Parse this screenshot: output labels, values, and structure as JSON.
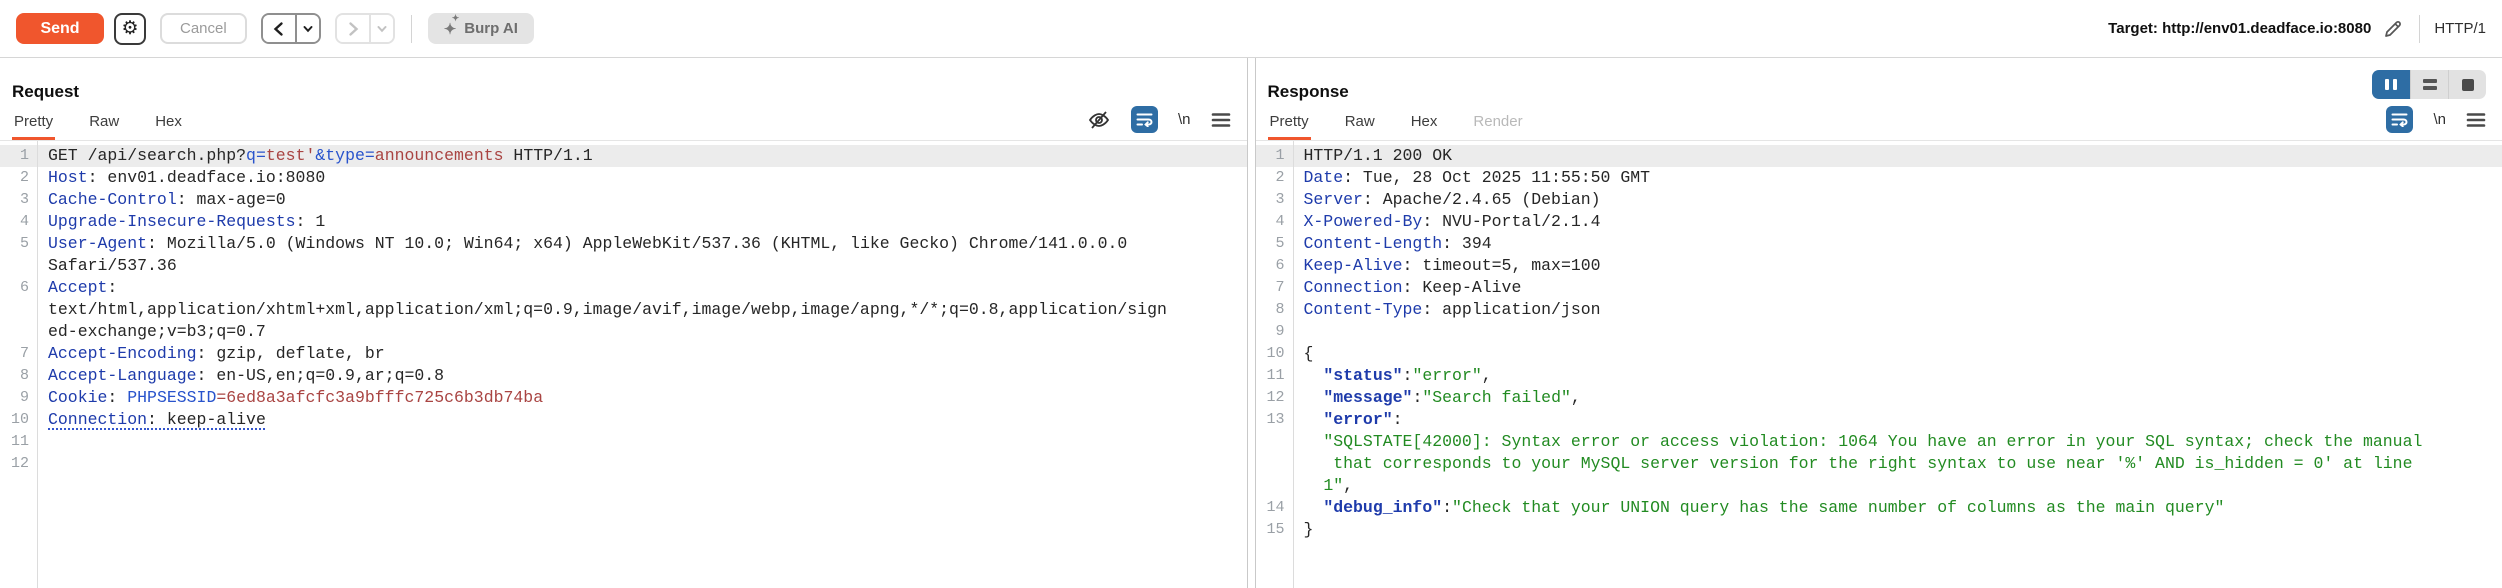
{
  "toolbar": {
    "send_label": "Send",
    "cancel_label": "Cancel",
    "burp_ai_label": "Burp AI",
    "target_text": "Target: http://env01.deadface.io:8080",
    "http_version": "HTTP/1",
    "accent_orange": "#f0562d",
    "accent_blue": "#2e6da4"
  },
  "request": {
    "title": "Request",
    "tabs": [
      {
        "label": "Pretty",
        "state": "active"
      },
      {
        "label": "Raw",
        "state": "normal"
      },
      {
        "label": "Hex",
        "state": "normal"
      }
    ],
    "newline_toggle_label": "\\n",
    "lines": [
      {
        "n": "1",
        "hl": true,
        "segs": [
          [
            "p",
            "GET /api/search.php?"
          ],
          [
            "q",
            "q="
          ],
          [
            "v",
            "test'"
          ],
          [
            "q",
            "&type="
          ],
          [
            "v",
            "announcements"
          ],
          [
            "p",
            " HTTP/1.1"
          ]
        ]
      },
      {
        "n": "2",
        "segs": [
          [
            "k",
            "Host"
          ],
          [
            "p",
            ": env01.deadface.io:8080"
          ]
        ]
      },
      {
        "n": "3",
        "segs": [
          [
            "k",
            "Cache-Control"
          ],
          [
            "p",
            ": max-age=0"
          ]
        ]
      },
      {
        "n": "4",
        "segs": [
          [
            "k",
            "Upgrade-Insecure-Requests"
          ],
          [
            "p",
            ": 1"
          ]
        ]
      },
      {
        "n": "5",
        "segs": [
          [
            "k",
            "User-Agent"
          ],
          [
            "p",
            ": Mozilla/5.0 (Windows NT 10.0; Win64; x64) AppleWebKit/537.36 (KHTML, like Gecko) Chrome/141.0.0.0"
          ]
        ]
      },
      {
        "n": "",
        "segs": [
          [
            "p",
            "Safari/537.36"
          ]
        ]
      },
      {
        "n": "6",
        "segs": [
          [
            "k",
            "Accept"
          ],
          [
            "p",
            ":"
          ]
        ]
      },
      {
        "n": "",
        "segs": [
          [
            "p",
            "text/html,application/xhtml+xml,application/xml;q=0.9,image/avif,image/webp,image/apng,*/*;q=0.8,application/sign"
          ]
        ]
      },
      {
        "n": "",
        "segs": [
          [
            "p",
            "ed-exchange;v=b3;q=0.7"
          ]
        ]
      },
      {
        "n": "7",
        "segs": [
          [
            "k",
            "Accept-Encoding"
          ],
          [
            "p",
            ": gzip, deflate, br"
          ]
        ]
      },
      {
        "n": "8",
        "segs": [
          [
            "k",
            "Accept-Language"
          ],
          [
            "p",
            ": en-US,en;q=0.9,ar;q=0.8"
          ]
        ]
      },
      {
        "n": "9",
        "segs": [
          [
            "k",
            "Cookie"
          ],
          [
            "p",
            ": "
          ],
          [
            "q",
            "PHPSESSID"
          ],
          [
            "v",
            "=6ed8a3afcfc3a9bfffc725c6b3db74ba"
          ]
        ]
      },
      {
        "n": "10",
        "u": true,
        "segs": [
          [
            "k",
            "Connection"
          ],
          [
            "p",
            ": keep-alive"
          ]
        ]
      },
      {
        "n": "11",
        "segs": []
      },
      {
        "n": "12",
        "segs": []
      }
    ]
  },
  "response": {
    "title": "Response",
    "tabs": [
      {
        "label": "Pretty",
        "state": "active"
      },
      {
        "label": "Raw",
        "state": "normal"
      },
      {
        "label": "Hex",
        "state": "normal"
      },
      {
        "label": "Render",
        "state": "disabled"
      }
    ],
    "newline_toggle_label": "\\n",
    "lines": [
      {
        "n": "1",
        "hl": true,
        "segs": [
          [
            "p",
            "HTTP/1.1 200 OK"
          ]
        ]
      },
      {
        "n": "2",
        "segs": [
          [
            "k",
            "Date"
          ],
          [
            "p",
            ": Tue, 28 Oct 2025 11:55:50 GMT"
          ]
        ]
      },
      {
        "n": "3",
        "segs": [
          [
            "k",
            "Server"
          ],
          [
            "p",
            ": Apache/2.4.65 (Debian)"
          ]
        ]
      },
      {
        "n": "4",
        "segs": [
          [
            "k",
            "X-Powered-By"
          ],
          [
            "p",
            ": NVU-Portal/2.1.4"
          ]
        ]
      },
      {
        "n": "5",
        "segs": [
          [
            "k",
            "Content-Length"
          ],
          [
            "p",
            ": 394"
          ]
        ]
      },
      {
        "n": "6",
        "segs": [
          [
            "k",
            "Keep-Alive"
          ],
          [
            "p",
            ": timeout=5, max=100"
          ]
        ]
      },
      {
        "n": "7",
        "segs": [
          [
            "k",
            "Connection"
          ],
          [
            "p",
            ": Keep-Alive"
          ]
        ]
      },
      {
        "n": "8",
        "segs": [
          [
            "k",
            "Content-Type"
          ],
          [
            "p",
            ": application/json"
          ]
        ]
      },
      {
        "n": "9",
        "segs": []
      },
      {
        "n": "10",
        "segs": [
          [
            "p",
            "{"
          ]
        ]
      },
      {
        "n": "11",
        "segs": [
          [
            "p",
            "  "
          ],
          [
            "j",
            "\"status\""
          ],
          [
            "p",
            ":"
          ],
          [
            "s",
            "\"error\""
          ],
          [
            "p",
            ","
          ]
        ]
      },
      {
        "n": "12",
        "segs": [
          [
            "p",
            "  "
          ],
          [
            "j",
            "\"message\""
          ],
          [
            "p",
            ":"
          ],
          [
            "s",
            "\"Search failed\""
          ],
          [
            "p",
            ","
          ]
        ]
      },
      {
        "n": "13",
        "segs": [
          [
            "p",
            "  "
          ],
          [
            "j",
            "\"error\""
          ],
          [
            "p",
            ":"
          ]
        ]
      },
      {
        "n": "",
        "segs": [
          [
            "p",
            "  "
          ],
          [
            "s",
            "\"SQLSTATE[42000]: Syntax error or access violation: 1064 You have an error in your SQL syntax; check the manual"
          ]
        ]
      },
      {
        "n": "",
        "segs": [
          [
            "p",
            "  "
          ],
          [
            "s",
            " that corresponds to your MySQL server version for the right syntax to use near '%' AND is_hidden = 0' at line"
          ]
        ]
      },
      {
        "n": "",
        "segs": [
          [
            "p",
            "  "
          ],
          [
            "s",
            "1\""
          ],
          [
            "p",
            ","
          ]
        ]
      },
      {
        "n": "14",
        "segs": [
          [
            "p",
            "  "
          ],
          [
            "j",
            "\"debug_info\""
          ],
          [
            "p",
            ":"
          ],
          [
            "s",
            "\"Check that your UNION query has the same number of columns as the main query\""
          ]
        ]
      },
      {
        "n": "15",
        "segs": [
          [
            "p",
            "}"
          ]
        ]
      }
    ]
  }
}
